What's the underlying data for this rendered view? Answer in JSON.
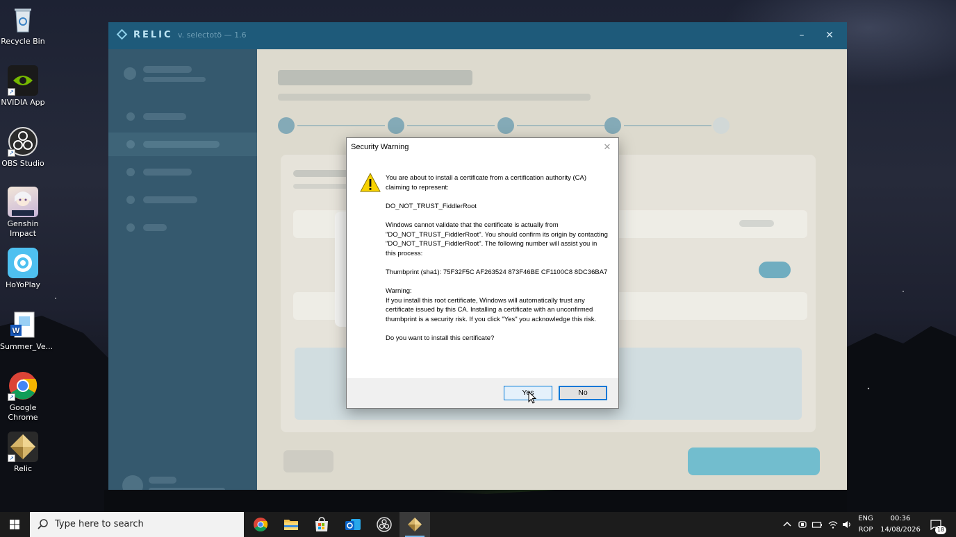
{
  "desktop": {
    "icons": [
      {
        "label": "Recycle Bin",
        "icon": "recycle-bin-icon"
      },
      {
        "label": "NVIDIA App",
        "icon": "nvidia-icon"
      },
      {
        "label": "OBS Studio",
        "icon": "obs-icon"
      },
      {
        "label": "Genshin Impact",
        "icon": "genshin-icon"
      },
      {
        "label": "HoYoPlay",
        "icon": "hoyoplay-icon"
      },
      {
        "label": "Summer_Ve...",
        "icon": "word-document-icon"
      },
      {
        "label": "Google Chrome",
        "icon": "chrome-icon"
      },
      {
        "label": "Relic",
        "icon": "relic-icon"
      }
    ]
  },
  "relic_window": {
    "title": "RELIC",
    "version": "v. selectotö — 1.6",
    "minimize_label": "–",
    "close_label": "✕"
  },
  "dialog": {
    "title": "Security Warning",
    "close_label": "✕",
    "paragraphs": [
      "You are about to install a certificate from a certification authority (CA) claiming to represent:",
      "DO_NOT_TRUST_FiddlerRoot",
      "Windows cannot validate that the certificate is actually from \"DO_NOT_TRUST_FiddlerRoot\". You should confirm its origin by contacting \"DO_NOT_TRUST_FiddlerRoot\". The following number will assist you in this process:",
      "Thumbprint (sha1): 75F32F5C AF263524 873F46BE CF1100C8 8DC36BA7",
      "Warning:\nIf you install this root certificate, Windows will automatically trust any certificate issued by this CA. Installing a certificate with an unconfirmed thumbprint is a security risk. If you click \"Yes\" you acknowledge this risk.",
      "Do you want to install this certificate?"
    ],
    "yes_label": "Yes",
    "no_label": "No"
  },
  "taskbar": {
    "search_placeholder": "Type here to search",
    "pinned_apps": [
      "chrome-icon",
      "file-explorer-icon",
      "microsoft-store-icon",
      "outlook-icon",
      "obs-icon",
      "relic-icon"
    ],
    "language_top": "ENG",
    "language_bottom": "ROP",
    "time": "00:36",
    "date": "14/08/2026",
    "notification_count": "18"
  },
  "colors": {
    "relic_titlebar": "#1e5a7a",
    "relic_sidebar": "#2a5066",
    "dialog_accent": "#0078d7",
    "taskbar": "#1c1c1c"
  }
}
